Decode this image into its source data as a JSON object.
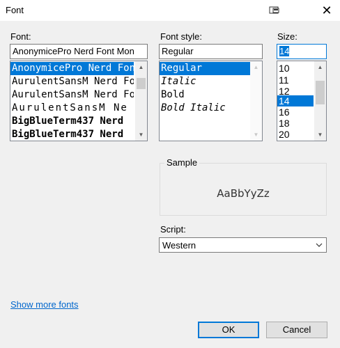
{
  "window": {
    "title": "Font",
    "restore_icon": "window-icon",
    "close_glyph": "✕"
  },
  "font": {
    "label": "Font:",
    "value": "AnonymicePro Nerd Font Mon",
    "items": [
      "AnonymicePro Nerd Font",
      "AurulentSansM Nerd Fon",
      "AurulentSansM Nerd Fon",
      "AurulentSansM Ne",
      "BigBlueTerm437 Nerd",
      "BigBlueTerm437 Nerd"
    ],
    "selected_index": 0
  },
  "style": {
    "label": "Font style:",
    "value": "Regular",
    "items": [
      "Regular",
      "Italic",
      "Bold",
      "Bold Italic"
    ],
    "selected_index": 0
  },
  "size": {
    "label": "Size:",
    "value": "14",
    "items": [
      "10",
      "11",
      "12",
      "14",
      "16",
      "18",
      "20"
    ],
    "selected_index": 3
  },
  "sample": {
    "label": "Sample",
    "text": "AaBbYyZz"
  },
  "script": {
    "label": "Script:",
    "value": "Western"
  },
  "show_more_fonts": "Show more fonts",
  "buttons": {
    "ok": "OK",
    "cancel": "Cancel"
  },
  "colors": {
    "accent": "#0078d7",
    "link": "#0066cc",
    "background": "#f0f0f0"
  }
}
